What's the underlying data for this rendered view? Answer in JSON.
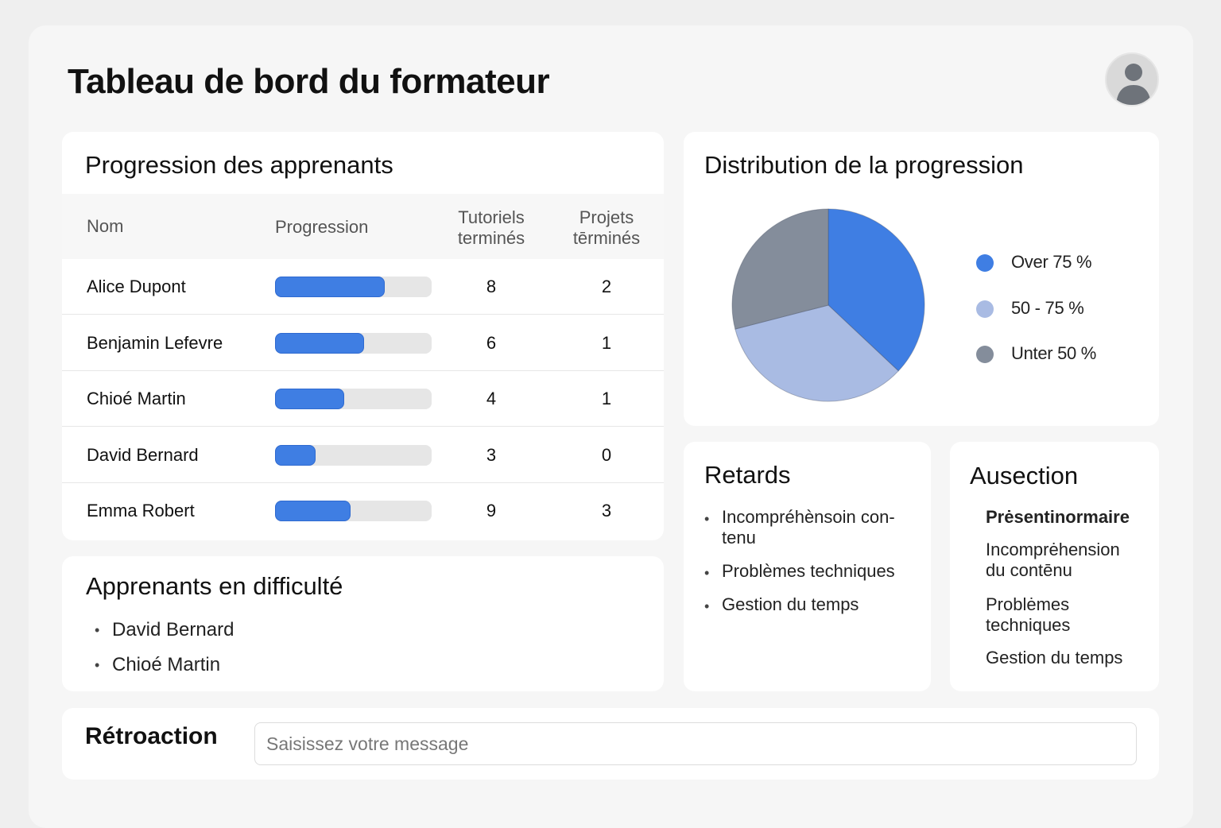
{
  "header": {
    "title": "Tableau de bord du formateur",
    "avatar_icon": "user-avatar-icon"
  },
  "progress": {
    "title": "Progression des apprenants",
    "columns": {
      "name": "Nom",
      "progress": "Progression",
      "tutorials_line1": "Tutoriels",
      "tutorials_line2": "terminés",
      "projects_line1": "Projets",
      "projects_line2": "tērminés"
    },
    "rows": [
      {
        "name": "Alice Dupont",
        "progress": 0.7,
        "tutorials": "8",
        "projects": "2"
      },
      {
        "name": "Benjamin Lefevre",
        "progress": 0.57,
        "tutorials": "6",
        "projects": "1"
      },
      {
        "name": "Chioé Martin",
        "progress": 0.44,
        "tutorials": "4",
        "projects": "1"
      },
      {
        "name": "David Bernard",
        "progress": 0.26,
        "tutorials": "3",
        "projects": "0"
      },
      {
        "name": "Emma Robert",
        "progress": 0.48,
        "tutorials": "9",
        "projects": "3"
      }
    ],
    "bar_color": "#3f7ee3"
  },
  "distribution": {
    "title": "Distribution de la progression",
    "legend": [
      {
        "label": "Over 75 %",
        "color": "#3f7ee3"
      },
      {
        "label": "50 - 75 %",
        "color": "#a9bbe3"
      },
      {
        "label": "Unter 50 %",
        "color": "#848d9b"
      }
    ]
  },
  "chart_data": {
    "type": "pie",
    "title": "Distribution de la progression",
    "categories": [
      "Over 75 %",
      "50 - 75 %",
      "Unter 50 %"
    ],
    "values": [
      37,
      34,
      29
    ],
    "colors": [
      "#3f7ee3",
      "#a9bbe3",
      "#848d9b"
    ],
    "legend_position": "right"
  },
  "struggling": {
    "title": "Apprenants en difficulté",
    "items": [
      "David Bernard",
      "Chioé Martin"
    ]
  },
  "delays": {
    "title": "Retards",
    "items": [
      {
        "line1": "Incompréhènsoin con-",
        "line2": "tenu"
      },
      {
        "line1": "Problèmes techniques",
        "line2": ""
      },
      {
        "line1": "Gestion du temps",
        "line2": ""
      }
    ]
  },
  "causes": {
    "title": "Ausection",
    "items": [
      {
        "line1": "Prėsentinormaire",
        "line2": ""
      },
      {
        "line1": "Incomprėhension",
        "line2": "du contēnu"
      },
      {
        "line1": "Problėmes",
        "line2": "techniques"
      },
      {
        "line1": "Gestion du temps",
        "line2": ""
      }
    ]
  },
  "feedback": {
    "title": "Rétroaction",
    "placeholder": "Saisissez votre message",
    "value": ""
  }
}
